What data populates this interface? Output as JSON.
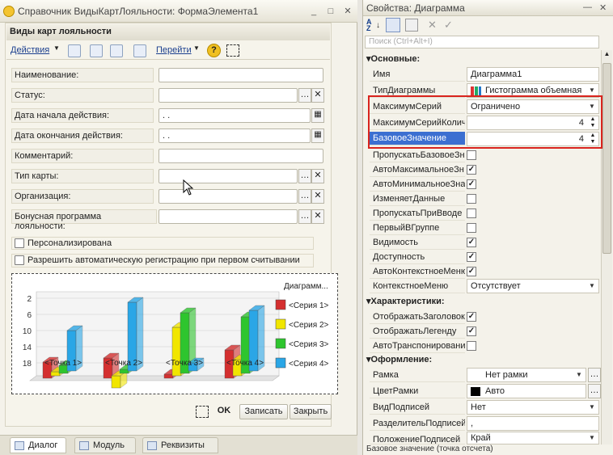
{
  "left_window": {
    "title": "Справочник ВидыКартЛояльности: ФормаЭлемента1",
    "form_header": "Виды карт лояльности",
    "toolbar": {
      "actions": "Действия",
      "goto": "Перейти"
    },
    "fields": [
      {
        "label": "Наименование:",
        "value": ""
      },
      {
        "label": "Статус:",
        "value": ""
      },
      {
        "label": "Дата начала действия:",
        "value": " .  ."
      },
      {
        "label": "Дата окончания действия:",
        "value": " .  ."
      },
      {
        "label": "Комментарий:",
        "value": ""
      },
      {
        "label": "Тип карты:",
        "value": ""
      },
      {
        "label": "Организация:",
        "value": ""
      },
      {
        "label": "Бонусная программа лояльности:",
        "value": ""
      }
    ],
    "checkboxes": [
      {
        "label": "Персонализирована",
        "checked": false
      },
      {
        "label": "Разрешить автоматическую регистрацию при первом считывании",
        "checked": false
      }
    ],
    "buttons": {
      "ok": "OK",
      "save": "Записать",
      "close": "Закрыть"
    },
    "tabs": [
      "Диалог",
      "Модуль",
      "Реквизиты"
    ]
  },
  "chart_data": {
    "type": "bar",
    "title": "Диаграмм...",
    "categories": [
      "Точка 1",
      "Точка 2",
      "Точка 3",
      "Точка 4"
    ],
    "ylim": [
      0,
      18
    ],
    "yticks": [
      2,
      6,
      10,
      14,
      18
    ],
    "ytick_labels": [
      "18",
      "14",
      "10",
      "6",
      "2"
    ],
    "series": [
      {
        "name": "<Серия 1>",
        "color": "#d42f2f",
        "values": [
          4,
          5,
          1,
          7
        ]
      },
      {
        "name": "<Серия 2>",
        "color": "#f1e600",
        "values": [
          1,
          -3,
          12,
          4
        ]
      },
      {
        "name": "<Серия 3>",
        "color": "#2ec52e",
        "values": [
          2,
          1,
          15,
          14
        ]
      },
      {
        "name": "<Серия 4>",
        "color": "#2aa6e6",
        "values": [
          10,
          17,
          2,
          15
        ]
      }
    ],
    "legend": "right",
    "grid": true
  },
  "right_panel": {
    "title": "Свойства: Диаграмма",
    "search_placeholder": "Поиск (Ctrl+Alt+I)",
    "sections": {
      "basic": "Основные:",
      "characteristics": "Характеристики:",
      "design": "Оформление:"
    },
    "props": [
      {
        "label": "Имя",
        "value": "Диаграмма1"
      },
      {
        "label": "ТипДиаграммы",
        "value": "Гистограмма объемная"
      },
      {
        "label": "МаксимумСерий",
        "value": "Ограничено"
      },
      {
        "label": "МаксимумСерийКолич",
        "value": "4"
      },
      {
        "label": "БазовоеЗначение",
        "value": "4"
      }
    ],
    "bool_props": [
      {
        "label": "ПропускатьБазовоеЗн",
        "checked": false
      },
      {
        "label": "АвтоМаксимальноеЗн",
        "checked": true
      },
      {
        "label": "АвтоМинимальноеЗна",
        "checked": true
      },
      {
        "label": "ИзменяетДанные",
        "checked": false
      },
      {
        "label": "ПропускатьПриВводе",
        "checked": false
      },
      {
        "label": "ПервыйВГруппе",
        "checked": false
      },
      {
        "label": "Видимость",
        "checked": true
      },
      {
        "label": "Доступность",
        "checked": true
      },
      {
        "label": "АвтоКонтекстноеМеню",
        "checked": true
      }
    ],
    "context_menu": {
      "label": "КонтекстноеМеню",
      "value": "Отсутствует"
    },
    "char_props": [
      {
        "label": "ОтображатьЗаголовок",
        "checked": true
      },
      {
        "label": "ОтображатьЛегенду",
        "checked": true
      },
      {
        "label": "АвтоТранспонировани",
        "checked": false
      }
    ],
    "design_props": [
      {
        "label": "Рамка",
        "value": "Нет рамки"
      },
      {
        "label": "ЦветРамки",
        "value": "Авто"
      },
      {
        "label": "ВидПодписей",
        "value": "Нет"
      },
      {
        "label": "РазделительПодписей",
        "value": ","
      },
      {
        "label": "ПоложениеПодписей",
        "value": "Край"
      }
    ],
    "status": "Базовое значение (точка отсчета)"
  }
}
